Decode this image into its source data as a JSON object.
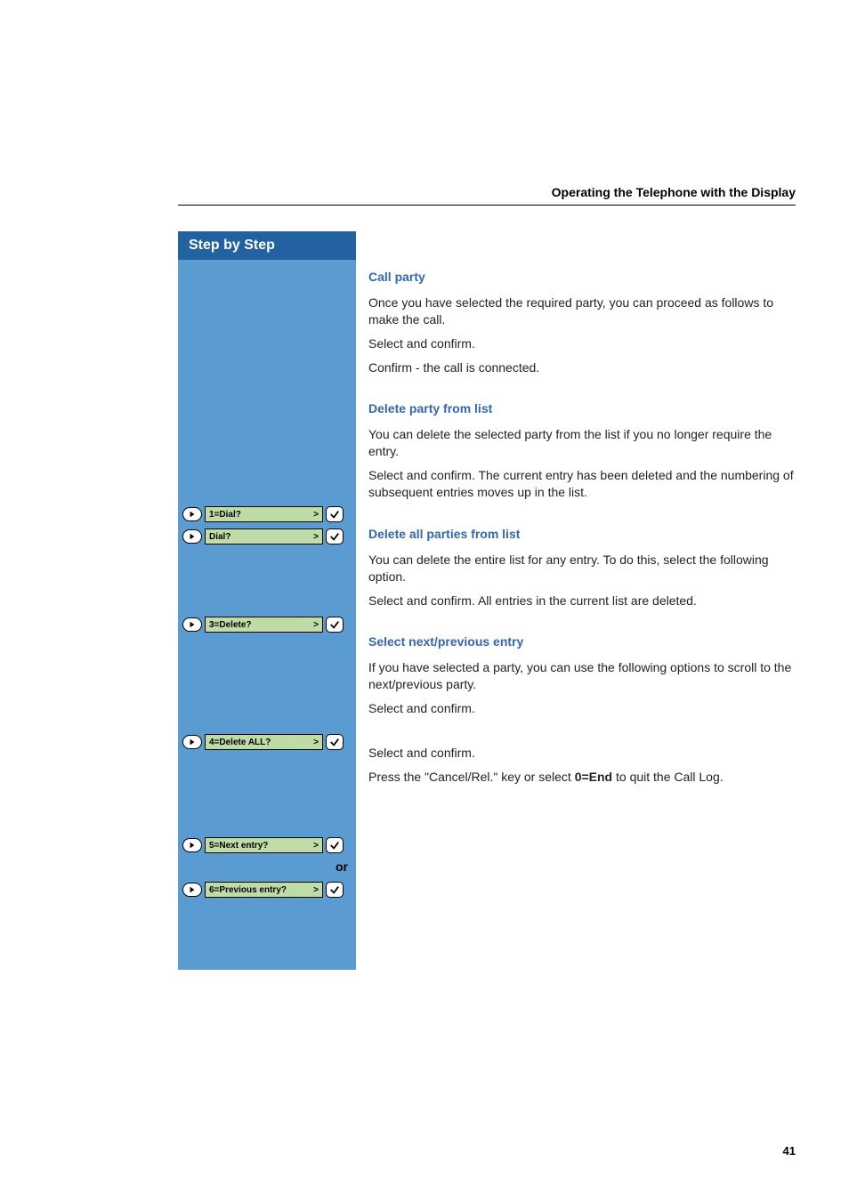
{
  "header": {
    "title": "Operating the Telephone with the Display"
  },
  "sidebar": {
    "heading": "Step by Step"
  },
  "steps": {
    "dial1": {
      "label": "1=Dial?",
      "arrow": ">"
    },
    "dial": {
      "label": "Dial?",
      "arrow": ">"
    },
    "delete3": {
      "label": "3=Delete?",
      "arrow": ">"
    },
    "deleteAll4": {
      "label": "4=Delete ALL?",
      "arrow": ">"
    },
    "next5": {
      "label": "5=Next entry?",
      "arrow": ">"
    },
    "or": "or",
    "prev6": {
      "label": "6=Previous entry?",
      "arrow": ">"
    }
  },
  "sections": {
    "callParty": {
      "title": "Call party",
      "intro": "Once you have selected the required party, you can proceed as follows to make the call.",
      "line1": "Select and confirm.",
      "line2": "Confirm - the call is connected."
    },
    "deleteParty": {
      "title": "Delete party from list",
      "intro": "You can delete the selected party from the list if you no longer require the entry.",
      "line1": "Select and confirm. The current entry has been deleted and the numbering of subsequent entries moves up in the list."
    },
    "deleteAll": {
      "title": "Delete all parties from list",
      "intro": "You can delete the entire list for any entry. To do this, select the following option.",
      "line1": "Select and confirm. All entries in the current list are deleted."
    },
    "selectNext": {
      "title": "Select next/previous entry",
      "intro": "If you have selected a party, you can use the following options to scroll to the next/previous party.",
      "line1": "Select and confirm.",
      "line2": "Select and confirm.",
      "line3a": "Press the \"Cancel/Rel.\" key or select ",
      "line3b": "0=End",
      "line3c": " to quit the Call Log."
    }
  },
  "pageNumber": "41"
}
